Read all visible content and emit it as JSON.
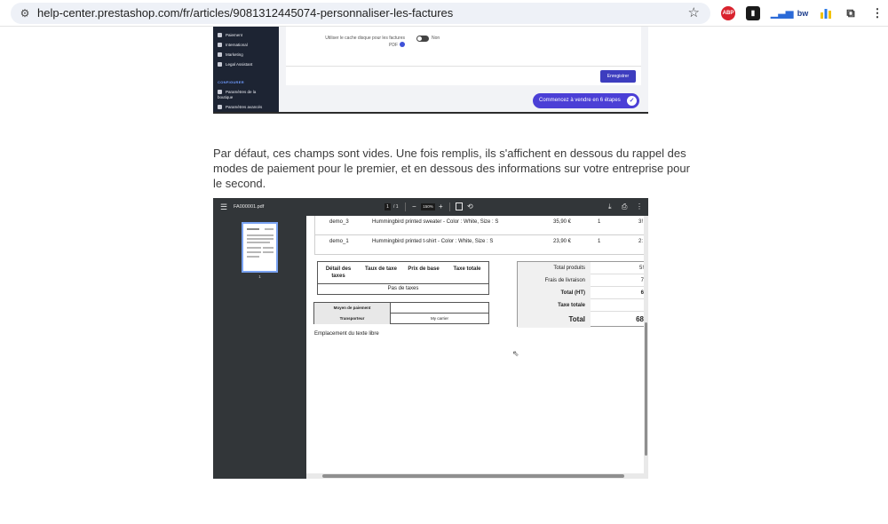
{
  "browser": {
    "url": "help-center.prestashop.com/fr/articles/9081312445074-personnaliser-les-factures",
    "extensions": [
      "ABP",
      "bw"
    ]
  },
  "admin_shot": {
    "sidebar_items": [
      "Paiement",
      "International",
      "Marketing",
      "Legal Assistant"
    ],
    "section_label": "CONFIGURER",
    "config_items": [
      "Paramètres de la boutique",
      "Paramètres avancés"
    ],
    "cache_label": "Utiliser le cache disque pour les factures PDF",
    "toggle_label": "Non",
    "save_button": "Enregistrer",
    "cta_button": "Commencez à vendre en 6 étapes"
  },
  "paragraph": "Par défaut, ces champs sont vides. Une fois remplis, ils s'affichent en dessous du rappel des modes de paiement pour le premier, et en dessous des informations sur votre entreprise pour le second.",
  "pdf": {
    "filename": "FA000001.pdf",
    "page_current": "1",
    "page_total": "/ 1",
    "zoom": "150%",
    "thumb_number": "1",
    "rows": [
      {
        "ref": "demo_3",
        "name": "Hummingbird printed sweater - Color : White, Size : S",
        "price": "35,90 €",
        "qty": "1",
        "total": "3!"
      },
      {
        "ref": "demo_1",
        "name": "Hummingbird printed t-shirt - Color : White, Size : S",
        "price": "23,90 €",
        "qty": "1",
        "total": "2:"
      }
    ],
    "tax_headers": [
      "Détail des taxes",
      "Taux de taxe",
      "Prix de base",
      "Taxe totale"
    ],
    "no_tax": "Pas de taxes",
    "payment_label": "Moyen de paiement",
    "payment_value": "",
    "carrier_label": "Transporteur",
    "carrier_value": "My carrier",
    "free_text": "Emplacement du texte libre",
    "totals": [
      {
        "label": "Total produits",
        "value": "5!"
      },
      {
        "label": "Frais de livraison",
        "value": "7"
      },
      {
        "label": "Total (HT)",
        "value": "6"
      },
      {
        "label": "Taxe totale",
        "value": ""
      },
      {
        "label": "Total",
        "value": "68"
      }
    ]
  }
}
